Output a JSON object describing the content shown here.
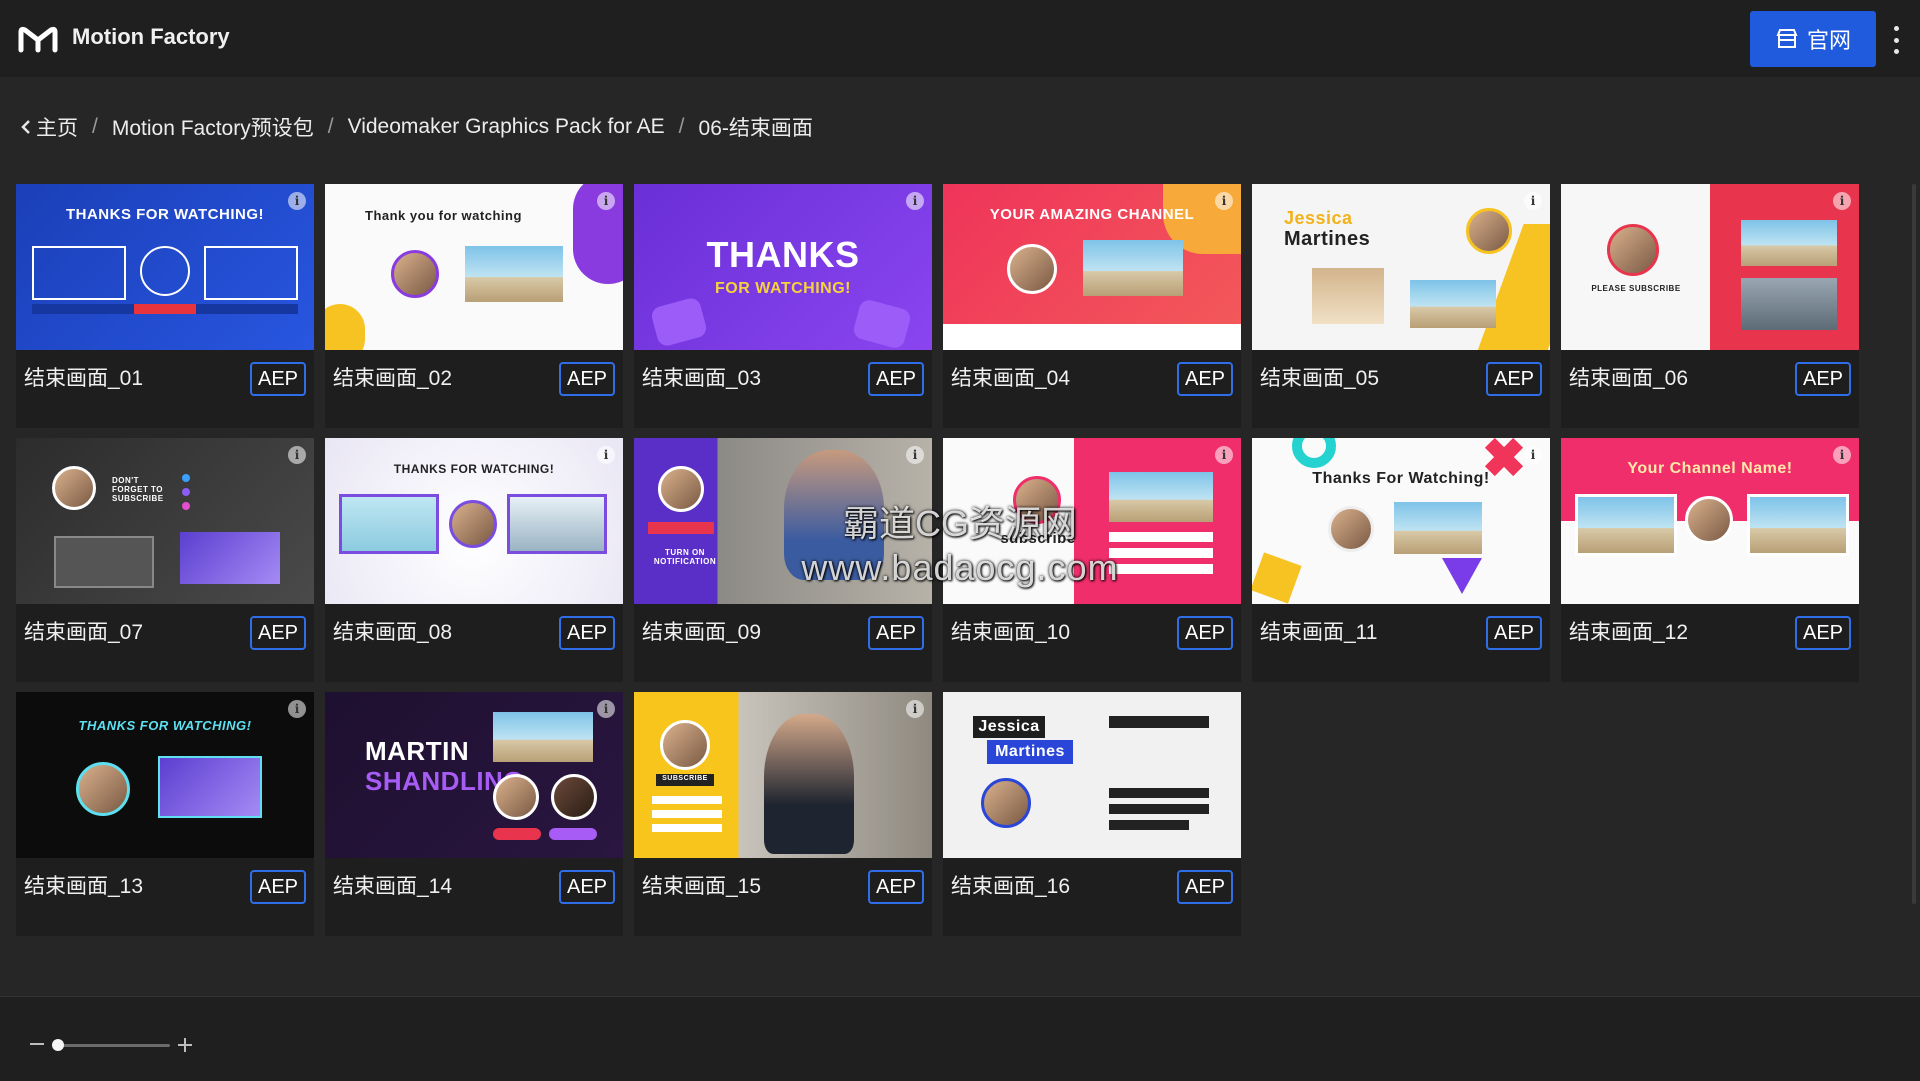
{
  "app": {
    "title": "Motion Factory"
  },
  "header": {
    "official_label": "官网"
  },
  "breadcrumb": {
    "items": [
      "主页",
      "Motion Factory预设包",
      "Videomaker Graphics Pack for AE",
      "06-结束画面"
    ],
    "separator": "/"
  },
  "cards": [
    {
      "title": "结束画面_01",
      "badge": "AEP",
      "thumb_text": "THANKS FOR WATCHING!"
    },
    {
      "title": "结束画面_02",
      "badge": "AEP",
      "thumb_text": "Thank you for watching"
    },
    {
      "title": "结束画面_03",
      "badge": "AEP",
      "thumb_text": "THANKS",
      "thumb_sub": "FOR WATCHING!"
    },
    {
      "title": "结束画面_04",
      "badge": "AEP",
      "thumb_text": "YOUR AMAZING CHANNEL"
    },
    {
      "title": "结束画面_05",
      "badge": "AEP",
      "thumb_text": "Jessica",
      "thumb_sub": "Martines"
    },
    {
      "title": "结束画面_06",
      "badge": "AEP",
      "thumb_text": "PLEASE SUBSCRIBE"
    },
    {
      "title": "结束画面_07",
      "badge": "AEP",
      "thumb_text": "DON'T FORGET TO SUBSCRIBE"
    },
    {
      "title": "结束画面_08",
      "badge": "AEP",
      "thumb_text": "THANKS FOR WATCHING!"
    },
    {
      "title": "结束画面_09",
      "badge": "AEP",
      "thumb_text": "TURN ON NOTIFICATION"
    },
    {
      "title": "结束画面_10",
      "badge": "AEP",
      "thumb_text": "subscribe"
    },
    {
      "title": "结束画面_11",
      "badge": "AEP",
      "thumb_text": "Thanks For Watching!"
    },
    {
      "title": "结束画面_12",
      "badge": "AEP",
      "thumb_text": "Your Channel Name!"
    },
    {
      "title": "结束画面_13",
      "badge": "AEP",
      "thumb_text": "THANKS FOR WATCHING!"
    },
    {
      "title": "结束画面_14",
      "badge": "AEP",
      "thumb_text": "MARTIN",
      "thumb_sub": "SHANDLING"
    },
    {
      "title": "结束画面_15",
      "badge": "AEP",
      "thumb_text": "SUBSCRIBE"
    },
    {
      "title": "结束画面_16",
      "badge": "AEP",
      "thumb_text": "Jessica",
      "thumb_sub": "Martines"
    }
  ],
  "watermark": {
    "line1": "霸道CG资源网",
    "line2": "www.badaocg.com"
  },
  "colors": {
    "accent": "#1f5bdc",
    "badge_border": "#2f6ee8",
    "background": "#262626"
  }
}
